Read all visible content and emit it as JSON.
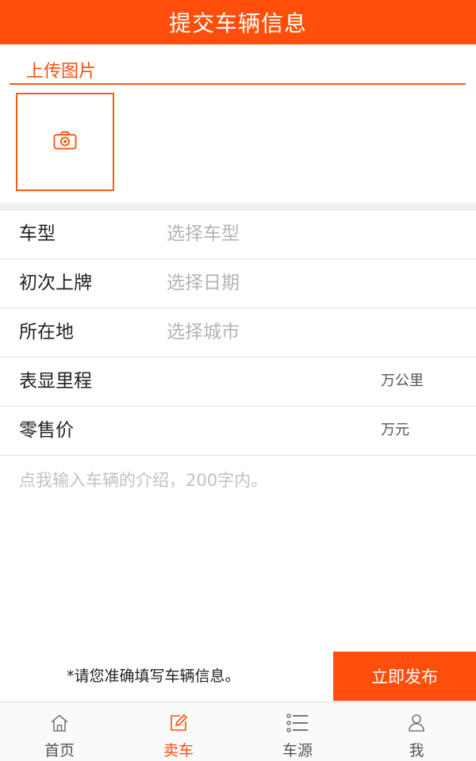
{
  "header": {
    "title": "提交车辆信息"
  },
  "upload": {
    "title": "上传图片",
    "camera_icon": "camera-icon"
  },
  "form": {
    "rows": [
      {
        "label": "车型",
        "placeholder": "选择车型"
      },
      {
        "label": "初次上牌",
        "placeholder": "选择日期"
      },
      {
        "label": "所在地",
        "placeholder": "选择城市"
      },
      {
        "label": "表显里程",
        "unit": "万公里"
      },
      {
        "label": "零售价",
        "unit": "万元"
      }
    ],
    "intro_placeholder": "点我输入车辆的介绍，200字内。"
  },
  "bottom": {
    "notice": "*请您准确填写车辆信息。",
    "publish_label": "立即发布"
  },
  "tabbar": {
    "items": [
      {
        "label": "首页",
        "icon": "home-icon",
        "active": false
      },
      {
        "label": "卖车",
        "icon": "edit-icon",
        "active": true
      },
      {
        "label": "车源",
        "icon": "list-icon",
        "active": false
      },
      {
        "label": "我",
        "icon": "user-icon",
        "active": false
      }
    ]
  },
  "colors": {
    "accent": "#ff4f0a",
    "inactive": "#555555"
  }
}
